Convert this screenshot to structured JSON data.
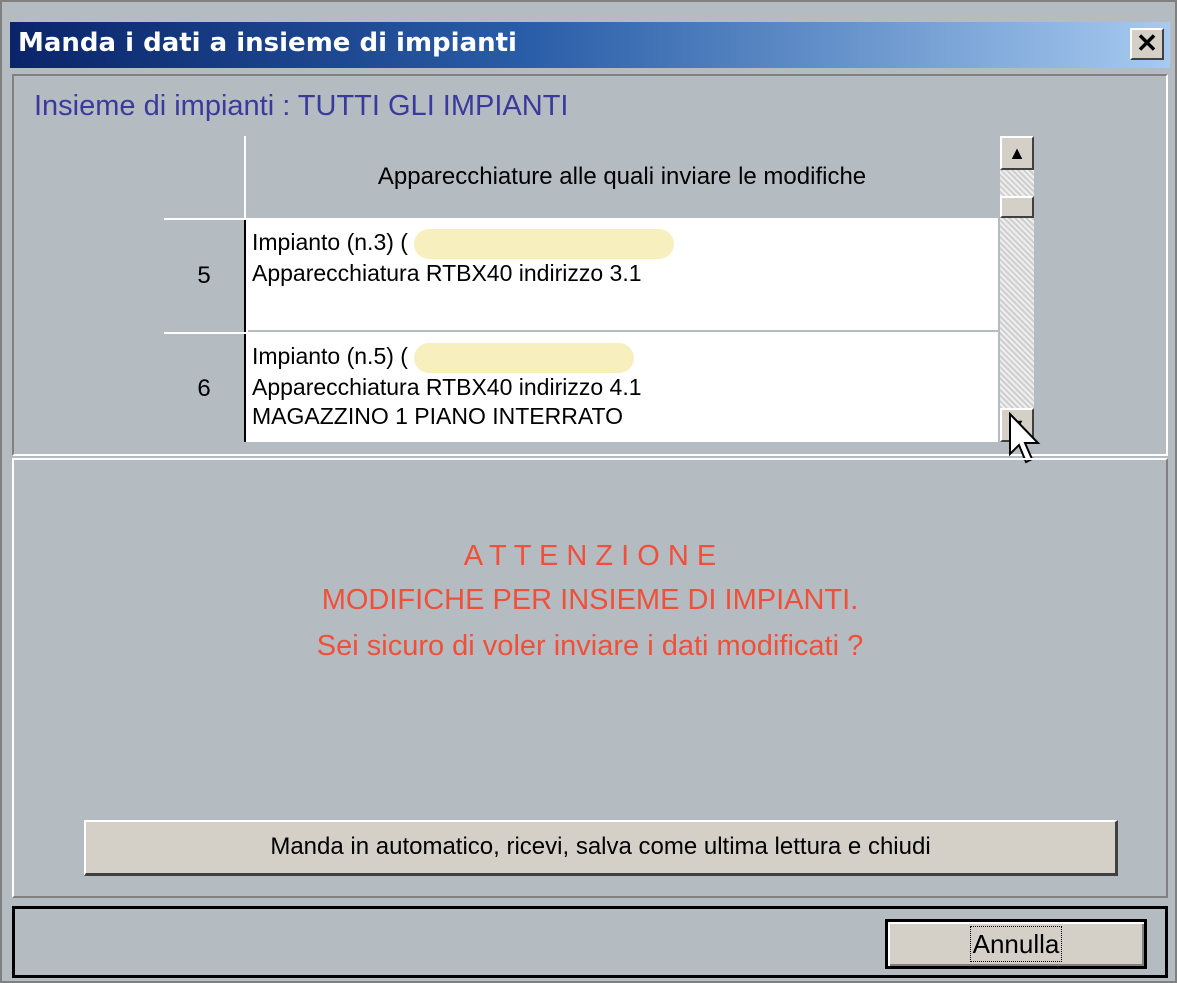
{
  "window": {
    "title": "Manda i dati a insieme di impianti",
    "close_label": "✕"
  },
  "group": {
    "label": "Insieme di impianti : TUTTI GLI IMPIANTI"
  },
  "grid": {
    "header": "Apparecchiature alle quali inviare le modifiche",
    "rows": [
      {
        "num": "5",
        "line1": "Impianto (n.3) (",
        "line2": "Apparecchiatura RTBX40 indirizzo 3.1",
        "line3": ""
      },
      {
        "num": "6",
        "line1": "Impianto (n.5) (",
        "line2": "Apparecchiatura RTBX40 indirizzo 4.1",
        "line3": "MAGAZZINO 1 PIANO INTERRATO"
      }
    ]
  },
  "warning": {
    "line1": "A T T E N Z I O N E",
    "line2": "MODIFICHE PER INSIEME DI IMPIANTI.",
    "line3": "Sei sicuro di voler inviare i dati modificati ?"
  },
  "buttons": {
    "auto_send": "Manda in automatico, ricevi, salva come ultima lettura e chiudi",
    "cancel": "Annulla"
  },
  "colors": {
    "warning_text": "#f0503a",
    "group_text": "#3a3a9c",
    "redaction": "#f7efbe"
  }
}
